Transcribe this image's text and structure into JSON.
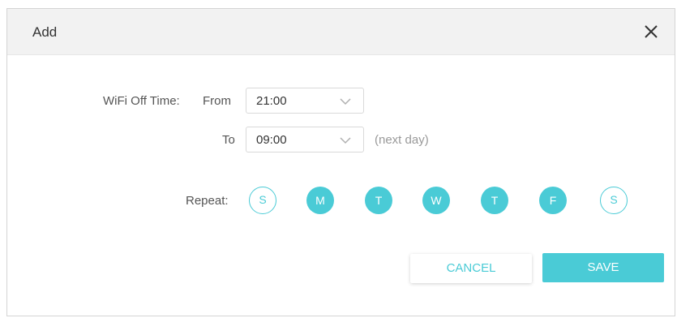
{
  "dialog": {
    "title": "Add",
    "close_icon": "close-icon"
  },
  "form": {
    "wifi_off_label": "WiFi Off Time:",
    "from_label": "From",
    "from_value": "21:00",
    "to_label": "To",
    "to_value": "09:00",
    "to_hint": "(next day)",
    "repeat_label": "Repeat:",
    "days": [
      {
        "letter": "S",
        "selected": false
      },
      {
        "letter": "M",
        "selected": true
      },
      {
        "letter": "T",
        "selected": true
      },
      {
        "letter": "W",
        "selected": true
      },
      {
        "letter": "T",
        "selected": true
      },
      {
        "letter": "F",
        "selected": true
      },
      {
        "letter": "S",
        "selected": false
      }
    ]
  },
  "actions": {
    "cancel_label": "CANCEL",
    "save_label": "SAVE"
  },
  "colors": {
    "accent": "#4acbd6",
    "header_bg": "#f2f2f2"
  }
}
